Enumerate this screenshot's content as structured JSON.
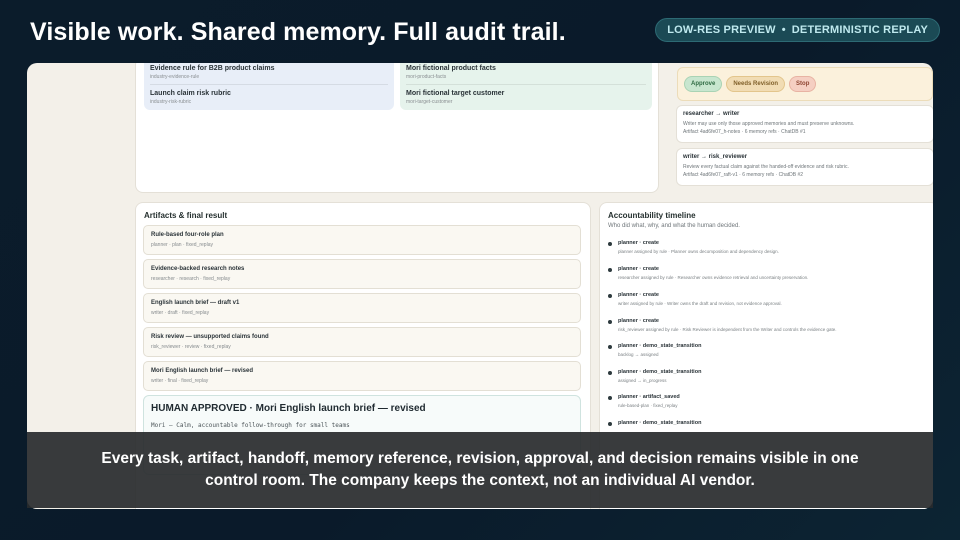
{
  "headline": "Visible work. Shared memory. Full audit trail.",
  "badge": {
    "left": "LOW-RES PREVIEW",
    "separator": "•",
    "right": "DETERMINISTIC REPLAY"
  },
  "memory": {
    "left": [
      {
        "title": "Evidence rule for B2B product claims",
        "sub": "industry-evidence-rule"
      },
      {
        "title": "Launch claim risk rubric",
        "sub": "industry-risk-rubric"
      }
    ],
    "right": [
      {
        "title": "Mori fictional product facts",
        "sub": "mori-product-facts"
      },
      {
        "title": "Mori fictional target customer",
        "sub": "mori-target-customer"
      }
    ]
  },
  "approval_buttons": {
    "approve": "Approve",
    "needs_revision": "Needs Revision",
    "stop": "Stop"
  },
  "handoffs": [
    {
      "title": "researcher → writer",
      "desc": "Writer may use only those approved memories and must preserve unknowns.",
      "meta": "Artifact 4ad6fe07_h-notes · 6 memory refs · ChatDB #1"
    },
    {
      "title": "writer → risk_reviewer",
      "desc": "Review every factual claim against the handed-off evidence and risk rubric.",
      "meta": "Artifact 4ad6fe07_raft-v1 · 6 memory refs · ChatDB #2"
    }
  ],
  "artifacts": {
    "title": "Artifacts & final result",
    "items": [
      {
        "title": "Rule-based four-role plan",
        "meta": "planner · plan · fixed_replay"
      },
      {
        "title": "Evidence-backed research notes",
        "meta": "researcher · research · fixed_replay"
      },
      {
        "title": "English launch brief — draft v1",
        "meta": "writer · draft · fixed_replay"
      },
      {
        "title": "Risk review — unsupported claims found",
        "meta": "risk_reviewer · review · fixed_replay"
      },
      {
        "title": "Mori English launch brief — revised",
        "meta": "writer · final · fixed_replay"
      }
    ],
    "approved": {
      "title": "HUMAN APPROVED · Mori English launch brief — revised",
      "body": "Mori — Calm, accountable follow-through for small teams"
    }
  },
  "timeline": {
    "title": "Accountability timeline",
    "subtitle": "Who did what, why, and what the human decided.",
    "items": [
      {
        "title": "planner · create",
        "desc": "planner assigned by rule · Planner owns decomposition and dependency design."
      },
      {
        "title": "planner · create",
        "desc": "researcher assigned by rule · Researcher owns evidence retrieval and uncertainty preservation."
      },
      {
        "title": "planner · create",
        "desc": "writer assigned by rule · Writer owns the draft and revision, not evidence approval."
      },
      {
        "title": "planner · create",
        "desc": "risk_reviewer assigned by rule · Risk Reviewer is independent from the Writer and controls the evidence gate."
      },
      {
        "title": "planner · demo_state_transition",
        "desc": "backlog → assigned"
      },
      {
        "title": "planner · demo_state_transition",
        "desc": "assigned → in_progress"
      },
      {
        "title": "planner · artifact_saved",
        "desc": "rule-based-plan · fixed_replay"
      },
      {
        "title": "planner · demo_state_transition",
        "desc": ""
      }
    ]
  },
  "caption": "Every task, artifact, handoff, memory reference, revision, approval, and decision remains visible in one control room. The company keeps the context, not an individual AI vendor.",
  "colors": {
    "background": "#0b1c2b",
    "approve": "#c8e6cf",
    "needs_revision": "#f1dcb4",
    "stop": "#f5cfc2"
  }
}
